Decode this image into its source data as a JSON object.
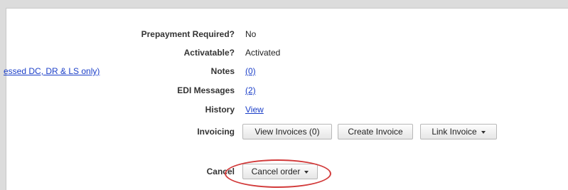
{
  "fields": {
    "prepayment": {
      "label": "Prepayment Required?",
      "value": "No"
    },
    "activatable": {
      "label": "Activatable?",
      "value": "Activated"
    },
    "notes": {
      "label": "Notes",
      "value": "(0)",
      "side_link": "essed DC, DR & LS only)"
    },
    "edi": {
      "label": "EDI Messages",
      "value": "(2)"
    },
    "history": {
      "label": "History",
      "value": "View"
    },
    "invoicing": {
      "label": "Invoicing",
      "buttons": {
        "view": "View Invoices (0)",
        "create": "Create Invoice",
        "link": "Link Invoice"
      }
    },
    "cancel": {
      "label": "Cancel",
      "button": "Cancel order"
    }
  },
  "colors": {
    "link": "#1a3ec8",
    "highlight": "#d23a3a"
  },
  "icons": {
    "dropdown": "caret-down-icon"
  }
}
